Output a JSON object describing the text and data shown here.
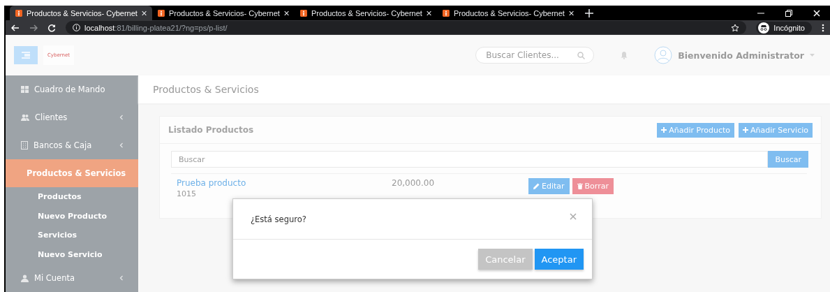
{
  "browser": {
    "tabs": [
      {
        "title": "Productos & Servicios- Cybernet",
        "selected": true
      },
      {
        "title": "Productos & Servicios- Cybernet",
        "selected": false
      },
      {
        "title": "Productos & Servicios- Cybernet",
        "selected": false
      },
      {
        "title": "Productos & Servicios- Cybernet",
        "selected": false
      }
    ],
    "address": {
      "host": "localhost",
      "rest": ":81/billing-platea21/?ng=ps/p-list/"
    },
    "profile": "Incógnito"
  },
  "header": {
    "logo": "Cybernet",
    "search_placeholder": "Buscar Clientes...",
    "user": "Bienvenido Administrator"
  },
  "sidebar": {
    "items": [
      {
        "label": "Cuadro de Mando",
        "kind": "link",
        "selected": false
      },
      {
        "label": "Clientes",
        "kind": "menu",
        "selected": false,
        "expanded": false
      },
      {
        "label": "Bancos & Caja",
        "kind": "menu",
        "selected": false,
        "expanded": false
      },
      {
        "label": "Productos & Servicios",
        "kind": "menu",
        "selected": true,
        "expanded": true,
        "children": [
          {
            "label": "Productos"
          },
          {
            "label": "Nuevo Producto"
          },
          {
            "label": "Servicios"
          },
          {
            "label": "Nuevo Servicio"
          }
        ]
      },
      {
        "label": "Mi Cuenta",
        "kind": "menu",
        "selected": false,
        "expanded": false
      }
    ]
  },
  "page_title": "Productos & Servicios",
  "card": {
    "title": "Listado Productos",
    "buttons": [
      "Añadir Producto",
      "Añadir Servicio"
    ],
    "search": {
      "placeholder": "Buscar",
      "button": "Buscar"
    },
    "rows": [
      {
        "name": "Prueba producto",
        "code": "1015",
        "price": "20,000.00",
        "edit": "Editar",
        "delete": "Borrar"
      }
    ]
  },
  "modal": {
    "message": "¿Está seguro?",
    "buttons": [
      {
        "label": "Cancelar",
        "kind": "secondary"
      },
      {
        "label": "Aceptar",
        "kind": "primary"
      }
    ]
  }
}
